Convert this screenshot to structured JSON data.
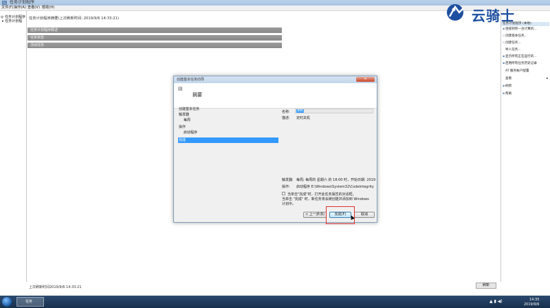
{
  "window": {
    "title": "任务计划程序"
  },
  "menu": {
    "items": [
      "文件(F)",
      "操作(A)",
      "查看(V)",
      "帮助(H)"
    ]
  },
  "tree": {
    "items": [
      "任务计划程序",
      "任务计划程"
    ]
  },
  "center": {
    "summary_line": "任务计划程序摘要(上次刷新时间: 2019/9/6 14:33:21)",
    "sections": [
      "任务计划程序概述",
      "任务状态",
      "活动任务"
    ]
  },
  "actions": {
    "header": "任务计划程序 (本地)",
    "items": [
      {
        "label": "连接到另一台计算机...",
        "icon": "computer-icon"
      },
      {
        "label": "创建基本任务...",
        "icon": "task-icon"
      },
      {
        "label": "创建任务...",
        "icon": "task-icon"
      },
      {
        "label": "导入任务...",
        "icon": ""
      },
      {
        "label": "显示所有正在运行的...",
        "icon": "list-icon"
      },
      {
        "label": "启用所有任务历史记录",
        "icon": "history-icon"
      },
      {
        "label": "AT 服务帐户配置",
        "icon": ""
      },
      {
        "label": "查看",
        "icon": ""
      },
      {
        "label": "刷新",
        "icon": "refresh-icon"
      },
      {
        "label": "帮助",
        "icon": "help-icon"
      }
    ]
  },
  "status": {
    "last_refresh": "上次刷新时间2019/9/6 14:33:21",
    "refresh_button": "刷新"
  },
  "taskbar": {
    "task_label": "任务",
    "time": "14:35",
    "date": "2019/9/6"
  },
  "logo": {
    "text": "云骑士"
  },
  "dialog": {
    "title": "创建基本任务向导",
    "heading": "摘要",
    "steps": [
      "创建基本任务",
      "触发器",
      "每周",
      "操作",
      "启动程序",
      "完成"
    ],
    "name_label": "名称:",
    "name_value": "关机",
    "desc_label": "描述:",
    "desc_value": "定时关机",
    "trigger_label": "触发器:",
    "trigger_value": "每周; 每周的 星期六 的 18:00 时，开始日期: 2019",
    "action_label": "操作:",
    "action_value": "启动程序 E:\\Windows\\System32\\CodeIntegrity",
    "checkbox_text": "当单击\"完成\"时，打开此任务属性的对话框。",
    "note_line1": "当单击 \"完成\" 时，新任务将会被创建并添加到 Windows",
    "note_line2": "计划中。",
    "back_button": "< 上一步(B)",
    "finish_button": "完成(F)",
    "cancel_button": "取消"
  }
}
